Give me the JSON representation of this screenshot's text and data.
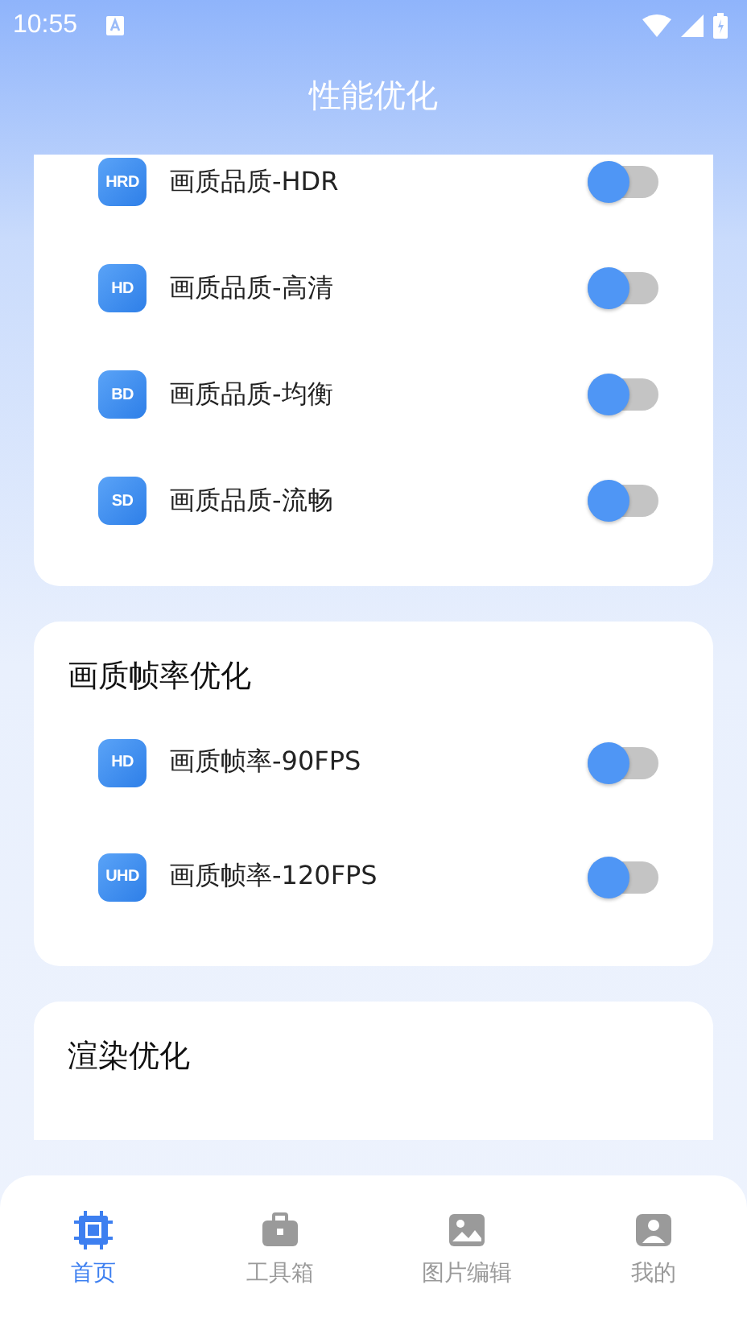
{
  "status_bar": {
    "time": "10:55"
  },
  "header": {
    "title": "性能优化"
  },
  "sections": [
    {
      "items": [
        {
          "badge": "HRD",
          "label": "画质品质-HDR",
          "on": false
        },
        {
          "badge": "HD",
          "label": "画质品质-高清",
          "on": false
        },
        {
          "badge": "BD",
          "label": "画质品质-均衡",
          "on": false
        },
        {
          "badge": "SD",
          "label": "画质品质-流畅",
          "on": false
        }
      ]
    },
    {
      "title": "画质帧率优化",
      "items": [
        {
          "badge": "HD",
          "label": "画质帧率-90FPS",
          "on": false
        },
        {
          "badge": "UHD",
          "label": "画质帧率-120FPS",
          "on": false
        }
      ]
    },
    {
      "title": "渲染优化"
    }
  ],
  "bottom_nav": [
    {
      "kind": "chip",
      "label": "首页",
      "selected": true
    },
    {
      "kind": "toolbox",
      "label": "工具箱",
      "selected": false
    },
    {
      "kind": "image",
      "label": "图片编辑",
      "selected": false
    },
    {
      "kind": "person",
      "label": "我的",
      "selected": false
    }
  ]
}
